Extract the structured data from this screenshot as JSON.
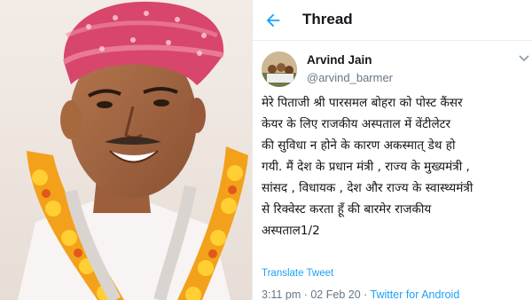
{
  "header": {
    "title": "Thread",
    "back_icon": "arrow-left-icon",
    "accent_color": "#1da1f2"
  },
  "tweet": {
    "author_name": "Arvind Jain",
    "author_handle": "@arvind_barmer",
    "lines": [
      "मेरे पिताजी श्री पारसमल बोहरा को पोस्ट कैंसर",
      "केयर के लिए राजकीय अस्पताल में वेंटीलेटर",
      "की सुविधा न होने के कारण अकस्मात् डेथ हो",
      "गयी. मैं देश के प्रधान मंत्री , राज्य के मुख्यमंत्री ,",
      "सांसद , विधायक , देश और राज्य के स्वास्थ्यमंत्री",
      "से रिक्वेस्ट करता हूँ की बारमेर राजकीय",
      "अस्पताल1/2"
    ],
    "translate_label": "Translate Tweet",
    "time": "3:11 pm",
    "separator": " · ",
    "date": "02 Feb 20",
    "source": "Twitter for Android"
  }
}
